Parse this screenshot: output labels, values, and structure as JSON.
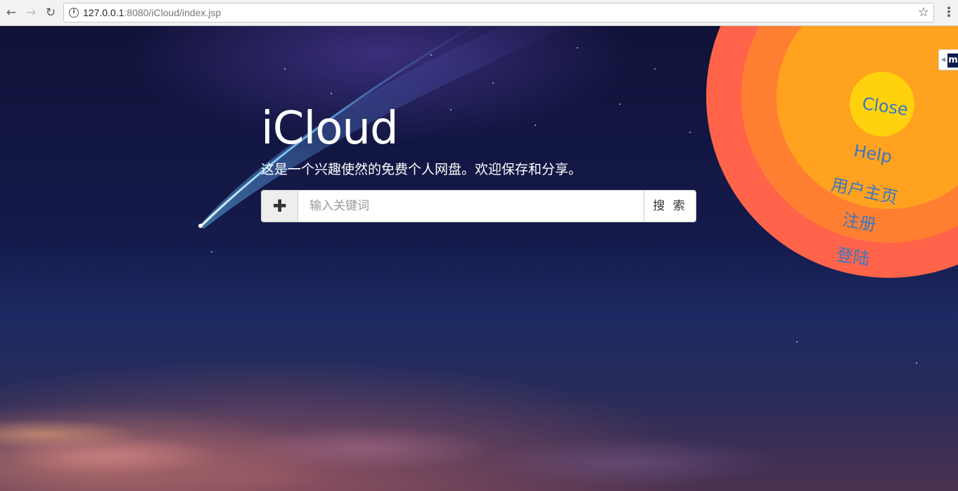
{
  "browser": {
    "url_host": "127.0.0.1",
    "url_rest": ":8080/iCloud/index.jsp",
    "back_icon": "arrow-left-icon",
    "forward_icon": "arrow-right-icon",
    "reload_icon": "reload-icon",
    "bookmark_icon": "star-icon",
    "menu_icon": "kebab-menu-icon"
  },
  "hero": {
    "title": "iCloud",
    "subtitle": "这是一个兴趣使然的免费个人网盘。欢迎保存和分享。"
  },
  "search": {
    "add_icon": "plus-icon",
    "placeholder": "输入关键词",
    "value": "",
    "button_label": "搜 索"
  },
  "circle_menu": {
    "close": "Close",
    "help": "Help",
    "home": "用户主页",
    "register": "注册",
    "login": "登陆",
    "colors": {
      "outer": "#ff644a",
      "middle": "#ff7f32",
      "inner": "#ffa21f",
      "center": "#ffd20d",
      "label": "#3b76c2"
    }
  },
  "extension_tab": {
    "logo_text": "m"
  }
}
